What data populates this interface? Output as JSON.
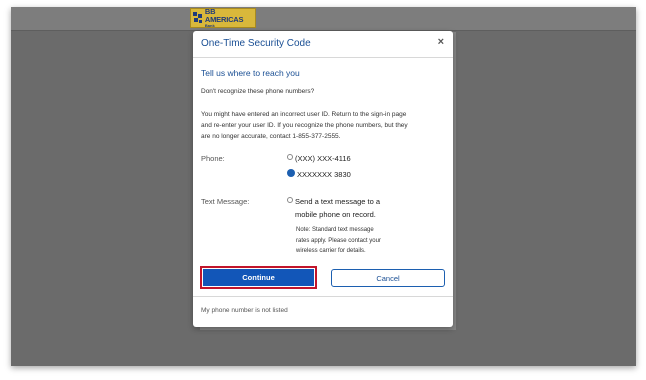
{
  "header": {
    "logo_title": "BB AMERICAS",
    "logo_subtitle": "Bank"
  },
  "modal": {
    "title": "One-Time Security Code",
    "close_symbol": "×",
    "section_title": "Tell us where to reach you",
    "intro": "Don't recognize these phone numbers?",
    "paragraph_lines": [
      "You might have entered an incorrect user ID. Return to the sign-in page",
      "and re-enter your user ID. If you recognize the phone numbers, but they",
      "are no longer accurate, contact 1-855-377-2555."
    ],
    "phone_label": "Phone:",
    "phone_options": [
      {
        "label": "(XXX) XXX-4116",
        "selected": false
      },
      {
        "label": "XXXXXXX 3830",
        "selected": true
      }
    ],
    "text_label": "Text Message:",
    "text_option_lines": [
      "Send a text message to a",
      "mobile phone on record."
    ],
    "text_option_selected": false,
    "note_lines": [
      "Note: Standard text message",
      "rates apply. Please contact your",
      "wireless carrier for details."
    ],
    "continue_label": "Continue",
    "cancel_label": "Cancel",
    "footer_link": "My phone number is not listed"
  },
  "colors": {
    "overlay": "#6b6b6b",
    "title_blue": "#1a4f94",
    "primary_button": "#1256b8",
    "highlight_border": "#c2152b",
    "logo_gold": "#d9b83b"
  }
}
